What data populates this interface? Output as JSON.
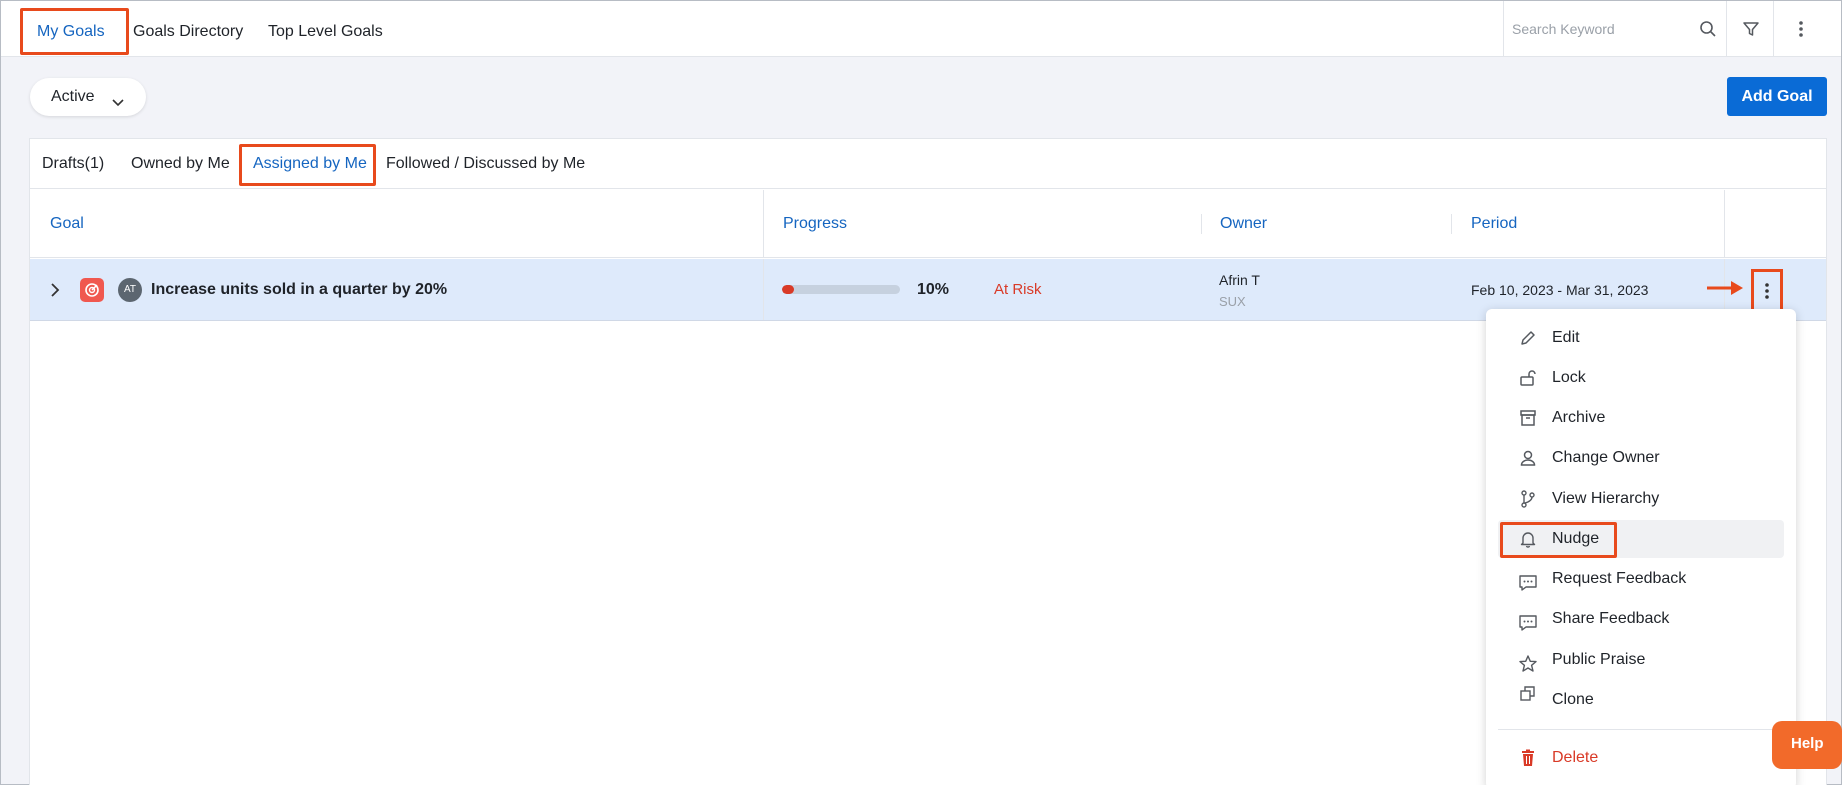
{
  "top_nav": {
    "tabs": [
      {
        "label": "My Goals",
        "active": true
      },
      {
        "label": "Goals Directory",
        "active": false
      },
      {
        "label": "Top Level Goals",
        "active": false
      }
    ],
    "search_placeholder": "Search Keyword",
    "icons": [
      "search-icon",
      "filter-icon",
      "more-vertical-icon"
    ]
  },
  "toolbar": {
    "status_filter": "Active",
    "add_goal_label": "Add Goal"
  },
  "sub_tabs": [
    {
      "label": "Drafts(1)",
      "active": false
    },
    {
      "label": "Owned by Me",
      "active": false
    },
    {
      "label": "Assigned by Me",
      "active": true
    },
    {
      "label": "Followed / Discussed by Me",
      "active": false
    }
  ],
  "table": {
    "columns": [
      "Goal",
      "Progress",
      "Owner",
      "Period"
    ],
    "rows": [
      {
        "avatar_initials": "AT",
        "goal": "Increase units sold in a quarter by 20%",
        "progress_fraction": 0.1,
        "progress_label": "10%",
        "status": "At Risk",
        "owner_name": "Afrin T",
        "owner_sub": "SUX",
        "period": "Feb 10, 2023 - Mar 31, 2023"
      }
    ]
  },
  "context_menu": {
    "items": [
      {
        "label": "Edit",
        "icon": "pencil-icon"
      },
      {
        "label": "Lock",
        "icon": "lock-icon"
      },
      {
        "label": "Archive",
        "icon": "archive-icon"
      },
      {
        "label": "Change Owner",
        "icon": "person-icon"
      },
      {
        "label": "View Hierarchy",
        "icon": "hierarchy-icon"
      },
      {
        "label": "Nudge",
        "icon": "bell-icon",
        "highlighted": true
      },
      {
        "label": "Request Feedback",
        "icon": "chat-icon"
      },
      {
        "label": "Share Feedback",
        "icon": "chat-icon"
      },
      {
        "label": "Public Praise",
        "icon": "star-icon"
      },
      {
        "label": "Clone",
        "icon": "clone-icon"
      },
      {
        "label": "Delete",
        "icon": "trash-icon",
        "danger": true
      }
    ]
  },
  "help_label": "Help",
  "colors": {
    "accent": "#0a6bd6",
    "link": "#1565c0",
    "annotation": "#e84a1c",
    "danger": "#d93a27",
    "row_highlight": "#deeafb"
  }
}
